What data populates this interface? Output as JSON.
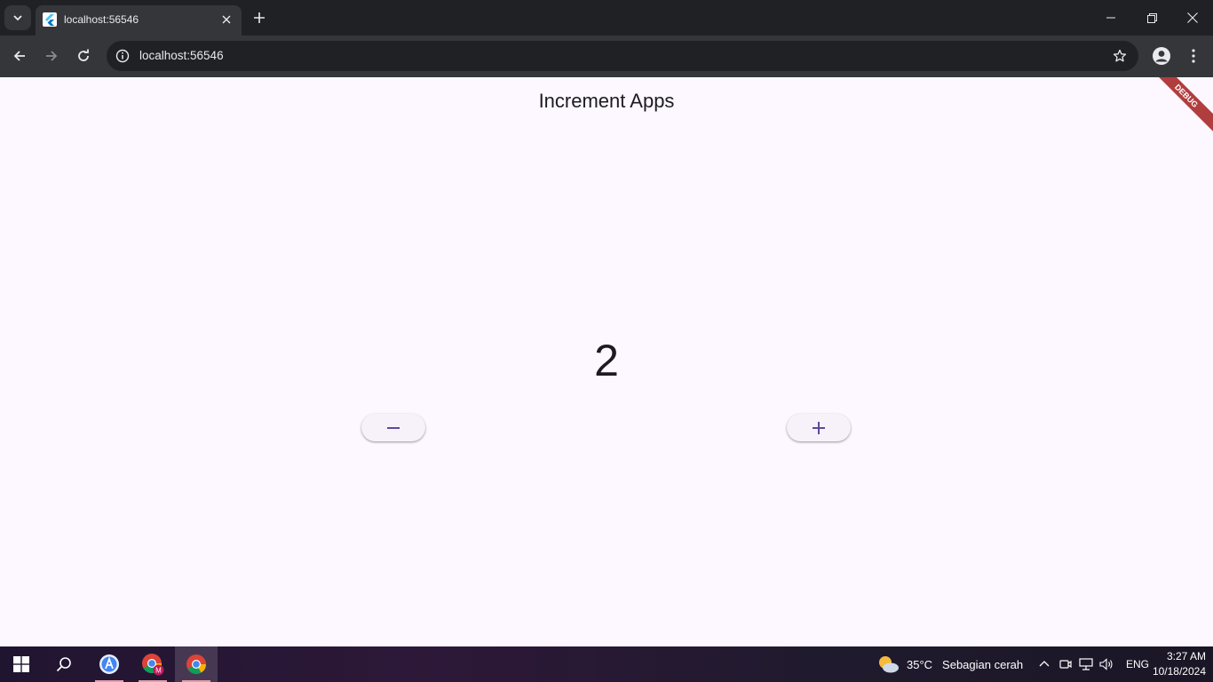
{
  "browser": {
    "tab": {
      "title": "localhost:56546"
    },
    "address": {
      "url": "localhost:56546"
    }
  },
  "app": {
    "title": "Increment Apps",
    "counter": "2",
    "decrement_symbol": "−",
    "increment_symbol": "+",
    "debug_banner": "DEBUG",
    "accent_color": "#5b4a9b",
    "background_color": "#fdf7ff"
  },
  "taskbar": {
    "weather": {
      "temp": "35°C",
      "condition": "Sebagian cerah"
    },
    "language": "ENG",
    "time": "3:27 AM",
    "date": "10/18/2024"
  }
}
